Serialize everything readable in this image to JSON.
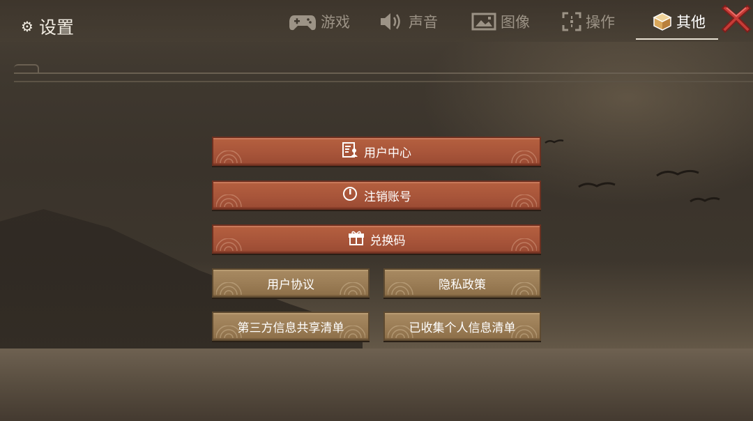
{
  "header": {
    "title": "设置",
    "tabs": [
      {
        "label": "游戏",
        "icon": "gamepad-icon",
        "active": false
      },
      {
        "label": "声音",
        "icon": "speaker-icon",
        "active": false
      },
      {
        "label": "图像",
        "icon": "image-icon",
        "active": false
      },
      {
        "label": "操作",
        "icon": "crosshair-icon",
        "active": false
      },
      {
        "label": "其他",
        "icon": "cube-icon",
        "active": true
      }
    ],
    "close_icon": "close-icon"
  },
  "menu": {
    "user_center": "用户中心",
    "cancel_account": "注销账号",
    "redeem_code": "兑换码",
    "user_agreement": "用户协议",
    "privacy_policy": "隐私政策",
    "third_party_list": "第三方信息共享清单",
    "collected_info_list": "已收集个人信息清单"
  },
  "colors": {
    "primary_button": "#a8553a",
    "secondary_button": "#9a7c55",
    "close_red": "#c73b36",
    "active_tab": "#ffffff",
    "inactive_tab": "#9c9386"
  }
}
